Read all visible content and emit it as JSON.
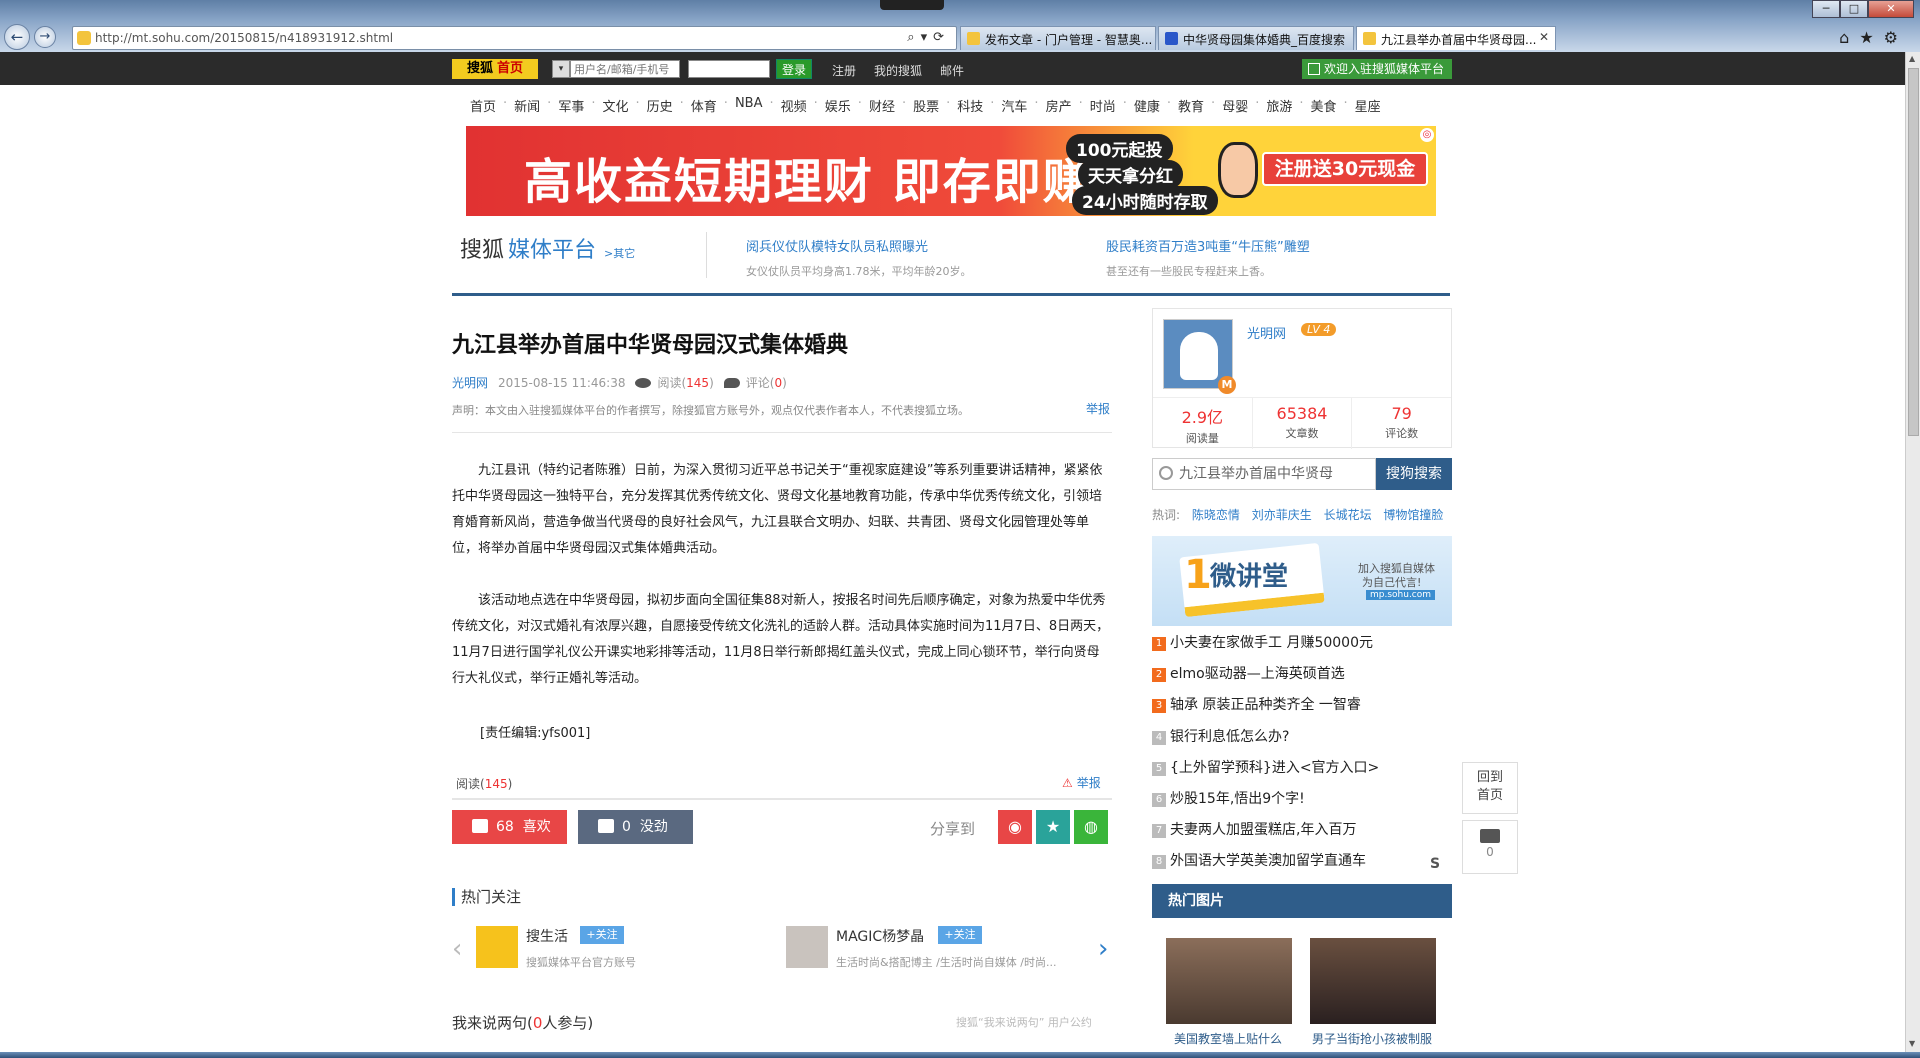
{
  "browser": {
    "url": "http://mt.sohu.com/20150815/n418931912.shtml",
    "tabs": [
      {
        "title": "发布文章 - 门户管理 - 智慧奥..."
      },
      {
        "title": "中华贤母园集体婚典_百度搜索"
      },
      {
        "title": "九江县举办首届中华贤母园..."
      }
    ],
    "window_buttons": {
      "min": "─",
      "max": "□",
      "close": "✕"
    }
  },
  "topbar": {
    "home_logo": "搜狐",
    "home_label": "首页",
    "username_placeholder": "用户名/邮箱/手机号",
    "login": "登录",
    "register": "注册",
    "my_sohu": "我的搜狐",
    "mail": "邮件",
    "join": "欢迎入驻搜狐媒体平台"
  },
  "channels": [
    "首页",
    "新闻",
    "军事",
    "文化",
    "历史",
    "体育",
    "NBA",
    "视频",
    "娱乐",
    "财经",
    "股票",
    "科技",
    "汽车",
    "房产",
    "时尚",
    "健康",
    "教育",
    "母婴",
    "旅游",
    "美食",
    "星座"
  ],
  "banner": {
    "main": "高收益短期理财 即存即赚",
    "p1": "100元起投",
    "p2": "天天拿分红",
    "p3": "24小时随时存取",
    "reg": "注册送30元现金"
  },
  "platform": {
    "logo_a": "搜狐",
    "logo_b": "媒体平台",
    "other": ">其它",
    "headlines": [
      {
        "title": "阅兵仪仗队模特女队员私照曝光",
        "sub": "女仪仗队员平均身高1.78米，平均年龄20岁。"
      },
      {
        "title": "股民耗资百万造3吨重“牛压熊”雕塑",
        "sub": "甚至还有一些股民专程赶来上香。"
      }
    ]
  },
  "article": {
    "title": "九江县举办首届中华贤母园汉式集体婚典",
    "source": "光明网",
    "datetime": "2015-08-15 11:46:38",
    "read_label": "阅读(",
    "read_count": "145",
    "comment_label": "评论(",
    "comment_count": "0",
    "close_paren": ")",
    "declaration": "声明：本文由入驻搜狐媒体平台的作者撰写，除搜狐官方账号外，观点仅代表作者本人，不代表搜狐立场。",
    "report": "举报",
    "para1": "九江县讯（特约记者陈雅）日前，为深入贯彻习近平总书记关于“重视家庭建设”等系列重要讲话精神，紧紧依托中华贤母园这一独特平台，充分发挥其优秀传统文化、贤母文化基地教育功能，传承中华优秀传统文化，引领培育婚育新风尚，营造争做当代贤母的良好社会风气，九江县联合文明办、妇联、共青团、贤母文化园管理处等单位，将举办首届中华贤母园汉式集体婚典活动。",
    "para2": "该活动地点选在中华贤母园，拟初步面向全国征集88对新人，按报名时间先后顺序确定，对象为热爱中华优秀传统文化，对汉式婚礼有浓厚兴趣，自愿接受传统文化洗礼的适龄人群。活动具体实施时间为11月7日、8日两天，11月7日进行国学礼仪公开课实地彩排等活动，11月8日举行新郎揭红盖头仪式，完成上同心锁环节，举行向贤母行大礼仪式，举行正婚礼等活动。",
    "editor": "[责任编辑:yfs001]",
    "bottom_read_label": "阅读(",
    "bottom_read_count": "145",
    "likes": "68",
    "like_label": "喜欢",
    "dislikes": "0",
    "dislike_label": "没劲",
    "share_label": "分享到"
  },
  "hot_follow": {
    "title": "热门关注",
    "items": [
      {
        "name": "搜生活",
        "btn": "+关注",
        "desc": "搜狐媒体平台官方账号"
      },
      {
        "name": "MAGIC杨梦晶",
        "btn": "+关注",
        "desc": "生活时尚&搭配博主 /生活时尚自媒体 /时尚..."
      }
    ]
  },
  "comment_section": {
    "prefix": "我来说两句(",
    "count": "0",
    "suffix": "人参与)",
    "hint": "搜狐“我来说两句” 用户公约"
  },
  "profile": {
    "name": "光明网",
    "level": "LV 4",
    "badge": "M",
    "stats": [
      {
        "value": "2.9亿",
        "label": "阅读量"
      },
      {
        "value": "65384",
        "label": "文章数"
      },
      {
        "value": "79",
        "label": "评论数"
      }
    ]
  },
  "search": {
    "value": "九江县举办首届中华贤母",
    "button": "搜狗搜索",
    "hot_label": "热词:",
    "hot_words": [
      "陈晓恋情",
      "刘亦菲庆生",
      "长城花坛",
      "博物馆撞脸"
    ]
  },
  "promo": {
    "one": "1",
    "big": "微讲堂",
    "r1": "加入搜狐自媒体",
    "r2": "为自己代言!",
    "r3": "mp.sohu.com"
  },
  "ranking": [
    {
      "n": "1",
      "t": "小夫妻在家做手工 月赚50000元"
    },
    {
      "n": "2",
      "t": "elmo驱动器—上海英硕首选"
    },
    {
      "n": "3",
      "t": "轴承 原装正品种类齐全 一智睿"
    },
    {
      "n": "4",
      "t": "银行利息低怎么办?"
    },
    {
      "n": "5",
      "t": "{上外留学预科}进入<官方入口>"
    },
    {
      "n": "6",
      "t": "炒股15年,悟出9个字!"
    },
    {
      "n": "7",
      "t": "夫妻两人加盟蛋糕店,年入百万"
    },
    {
      "n": "8",
      "t": "外国语大学英美澳加留学直通车"
    }
  ],
  "ranking_mark": "S",
  "hot_pics": {
    "title": "热门图片",
    "items": [
      {
        "caption": "美国教室墙上贴什么"
      },
      {
        "caption": "男子当街抢小孩被制服"
      }
    ]
  },
  "float": {
    "back_top": "回到",
    "back_bottom": "首页",
    "comments": "0"
  }
}
